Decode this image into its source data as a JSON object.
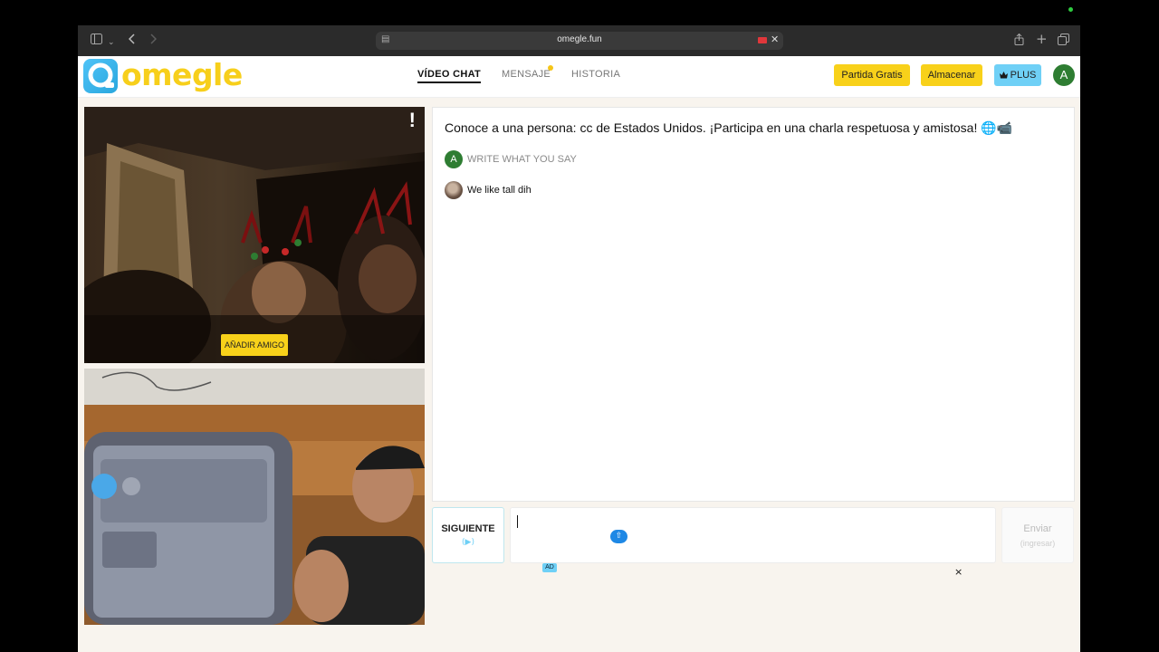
{
  "browser": {
    "url": "omegle.fun",
    "icons": [
      "sidebar-icon",
      "chevron-down-icon",
      "back-icon",
      "forward-icon",
      "page-icon",
      "camera-icon",
      "close-icon",
      "share-icon",
      "new-tab-icon",
      "tabs-icon"
    ]
  },
  "header": {
    "logo_text": "omegle",
    "nav": [
      {
        "label": "VÍDEO CHAT",
        "active": true
      },
      {
        "label": "MENSAJE",
        "badge": true
      },
      {
        "label": "HISTORIA",
        "active": false
      }
    ],
    "buttons": {
      "free_match": "Partida Gratis",
      "store": "Almacenar",
      "plus": "PLUS",
      "plus_icon": "crown-icon"
    },
    "avatar_letter": "A"
  },
  "video": {
    "report_label": "!",
    "add_friend": "AÑADIR AMIGO"
  },
  "chat": {
    "title": "Conoce a una persona: cc de Estados Unidos. ¡Participa en una charla respetuosa y amistosa! 🌐📹",
    "system_avatar": "A",
    "system_prompt": "WRITE WHAT YOU SAY",
    "messages": [
      {
        "text": "We like tall dih",
        "avatar": "stranger-avatar"
      }
    ]
  },
  "controls": {
    "next_label": "SIGUIENTE",
    "next_sub": "(▶)",
    "input_value": "",
    "send_label": "Enviar",
    "send_sub": "(ingresar)",
    "ad_label": "AD",
    "ad_close": "×"
  },
  "colors": {
    "brand_yellow": "#f8d11a",
    "brand_blue": "#6fd0f6",
    "avatar_green": "#2e7d32",
    "toolbar": "#2b2b2b",
    "page_bg": "#f8f4ee"
  }
}
